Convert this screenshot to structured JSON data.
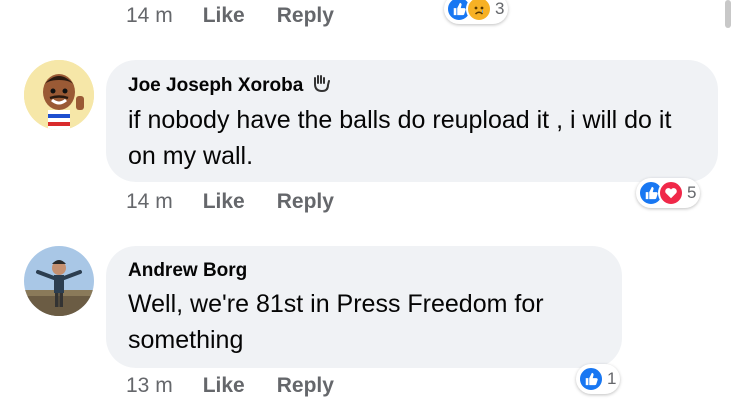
{
  "top_meta": {
    "time": "14 m",
    "like_label": "Like",
    "reply_label": "Reply",
    "reaction_count": "3"
  },
  "comments": [
    {
      "author": "Joe Joseph Xoroba",
      "text": "if nobody have the balls do reupload it , i will do it on my wall.",
      "time": "14 m",
      "like_label": "Like",
      "reply_label": "Reply",
      "reaction_count": "5",
      "badge_icon": "wave-hand-icon"
    },
    {
      "author": "Andrew Borg",
      "text": "Well, we're 81st in Press Freedom for something",
      "time": "13 m",
      "like_label": "Like",
      "reply_label": "Reply",
      "reaction_count": "1"
    }
  ],
  "colors": {
    "like_blue": "#1877f2",
    "love_red": "#f02849",
    "sad_yellow": "#f7b125",
    "bubble_gray": "#f0f2f5",
    "meta_gray": "#65676b"
  }
}
